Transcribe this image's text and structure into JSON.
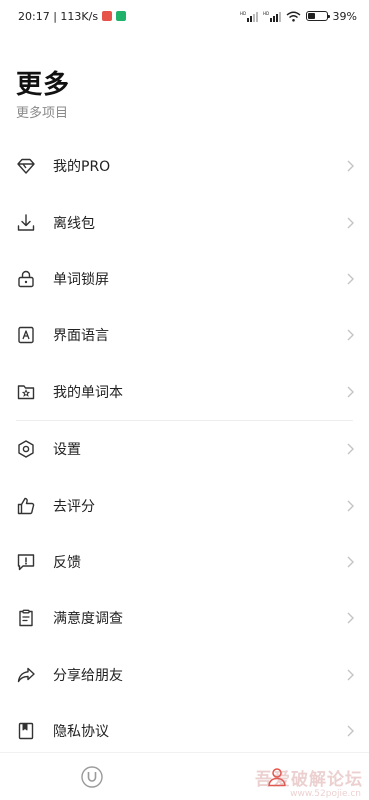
{
  "status_bar": {
    "time_speed": "20:17 | 113K/s",
    "battery": "39%",
    "battery_level": 0.39,
    "badge_colors": [
      "#e5534b",
      "#20b26b"
    ]
  },
  "header": {
    "title": "更多",
    "subtitle": "更多项目"
  },
  "menu": {
    "group1": [
      {
        "label": "我的PRO",
        "icon": "diamond-icon"
      },
      {
        "label": "离线包",
        "icon": "download-icon"
      },
      {
        "label": "单词锁屏",
        "icon": "lock-icon"
      },
      {
        "label": "界面语言",
        "icon": "language-icon"
      },
      {
        "label": "我的单词本",
        "icon": "folder-star-icon"
      }
    ],
    "group2": [
      {
        "label": "设置",
        "icon": "settings-hexagon-icon"
      },
      {
        "label": "去评分",
        "icon": "thumbs-up-icon"
      },
      {
        "label": "反馈",
        "icon": "feedback-icon"
      },
      {
        "label": "满意度调查",
        "icon": "survey-clipboard-icon"
      },
      {
        "label": "分享给朋友",
        "icon": "share-arrow-icon"
      },
      {
        "label": "隐私协议",
        "icon": "bookmark-doc-icon"
      }
    ]
  },
  "bottom_nav": {
    "tabs": [
      {
        "icon": "u-circle-icon",
        "active": false
      },
      {
        "icon": "profile-icon",
        "active": true
      }
    ],
    "accent_color": "#e5534b"
  },
  "watermark": {
    "text": "吾爱破解论坛",
    "sub": "www.52pojie.cn"
  }
}
